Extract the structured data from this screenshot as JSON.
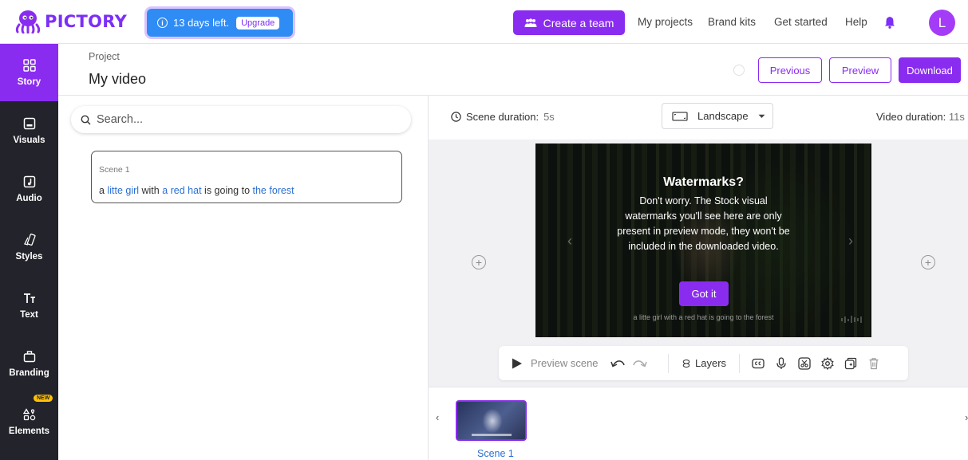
{
  "app": {
    "logo_text": "PICTORY",
    "brand_color": "#8a2cf0"
  },
  "topbar": {
    "trial_text": "13 days left.",
    "upgrade_label": "Upgrade",
    "create_team_label": "Create a team",
    "nav": [
      "My projects",
      "Brand kits",
      "Get started",
      "Help"
    ],
    "avatar_initial": "L"
  },
  "sidebar": {
    "items": [
      {
        "label": "Story",
        "icon": "layout-grid-icon",
        "active": true
      },
      {
        "label": "Visuals",
        "icon": "image-icon"
      },
      {
        "label": "Audio",
        "icon": "music-note-icon"
      },
      {
        "label": "Styles",
        "icon": "swatches-icon"
      },
      {
        "label": "Text",
        "icon": "text-size-icon"
      },
      {
        "label": "Branding",
        "icon": "briefcase-icon"
      },
      {
        "label": "Elements",
        "icon": "shapes-icon",
        "badge": "NEW"
      }
    ]
  },
  "project": {
    "label": "Project",
    "title": "My video",
    "previous_label": "Previous",
    "preview_label": "Preview",
    "download_label": "Download"
  },
  "script_panel": {
    "search_placeholder": "Search...",
    "scenes": [
      {
        "label": "Scene 1",
        "text": {
          "t1": "a ",
          "h1": "litte girl",
          "t2": " with ",
          "h2": "a red hat",
          "t3": " is going to ",
          "h3": "the forest"
        }
      }
    ]
  },
  "preview": {
    "scene_duration_label": "Scene duration:",
    "scene_duration_value": "5s",
    "orientation": "Landscape",
    "video_duration_label": "Video duration:",
    "video_duration_value": "11s",
    "watermark_title": "Watermarks?",
    "watermark_body": "Don't worry. The Stock visual watermarks you'll see here are only present in preview mode, they won't be included in the downloaded video.",
    "got_it_label": "Got it",
    "caption": "a litte girl with a red hat is going to the forest"
  },
  "toolbar": {
    "preview_scene_label": "Preview scene",
    "layers_label": "Layers"
  },
  "timeline": {
    "scenes": [
      {
        "label": "Scene 1"
      }
    ]
  }
}
